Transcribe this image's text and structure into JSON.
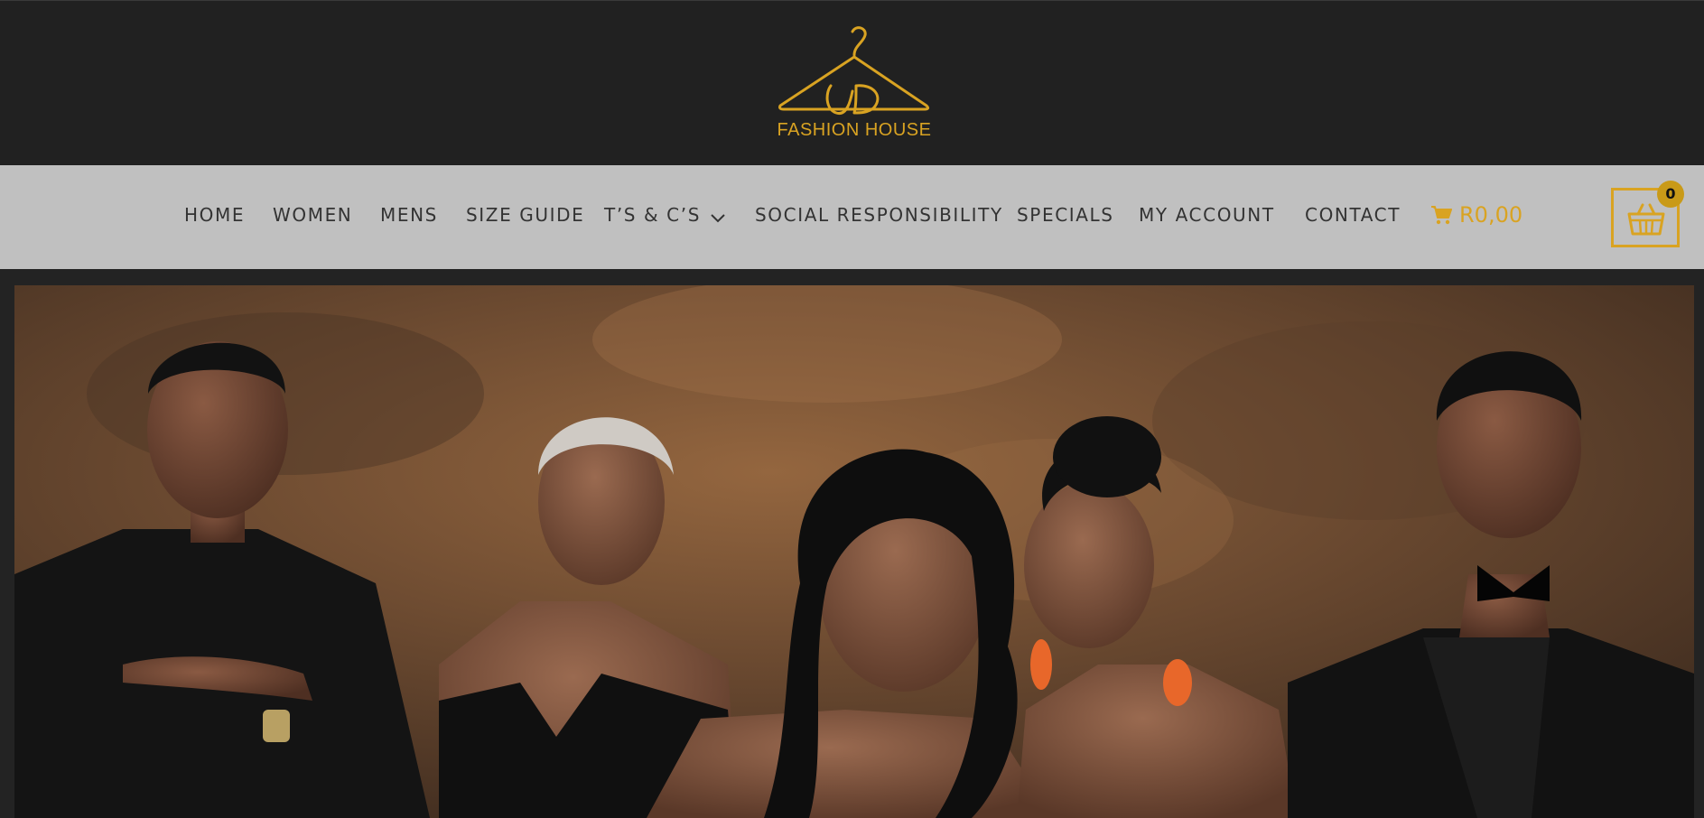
{
  "brand": {
    "logo_text": "FASHION HOUSE",
    "accent_color": "#d9a322"
  },
  "nav": {
    "items": [
      {
        "label": "HOME"
      },
      {
        "label": "WOMEN"
      },
      {
        "label": "MENS"
      },
      {
        "label": "SIZE GUIDE"
      },
      {
        "label": "T’S & C’S",
        "has_dropdown": true
      },
      {
        "label": "SOCIAL RESPONSIBILITY"
      },
      {
        "label": "SPECIALS"
      },
      {
        "label": "MY ACCOUNT"
      },
      {
        "label": "CONTACT"
      }
    ]
  },
  "cart": {
    "total": "R0,00",
    "count": "0",
    "icon": "shopping-cart-icon",
    "basket_icon": "basket-icon"
  },
  "hero": {
    "image": "group-portrait-photo"
  }
}
